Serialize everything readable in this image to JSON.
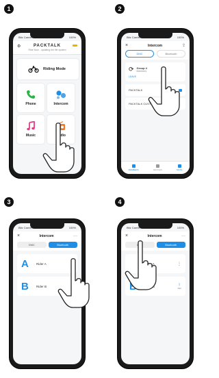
{
  "steps": [
    {
      "badge": "1"
    },
    {
      "badge": "2"
    },
    {
      "badge": "3"
    },
    {
      "badge": "4"
    }
  ],
  "status_bar": {
    "carrier": "Bitz Carrier",
    "time": "9:41 AM",
    "battery": "100%"
  },
  "screen1": {
    "brand": "PACKTALK",
    "tagline": "Ride Now - updating the file system",
    "riding_mode": "Riding Mode",
    "phone": "Phone",
    "intercom": "Intercom",
    "music": "Music",
    "radio": "Radio"
  },
  "screen2": {
    "title": "Intercom",
    "tab_dmc": "DMC",
    "tab_bluetooth": "Bluetooth",
    "group_name": "Group 4",
    "group_sub": "Members",
    "group_link": "LEAVE",
    "row1": "PACKTALK",
    "row2": "PACKTALK CUSTOM",
    "nav": [
      "MEMBERS",
      "DEVICES",
      "MUTE"
    ]
  },
  "screen3": {
    "title": "Intercom",
    "seg_dmc": "DMC",
    "seg_bluetooth": "Bluetooth",
    "rider_a_letter": "A",
    "rider_a": "Rider A",
    "rider_b_letter": "B",
    "rider_b": "Rider B"
  },
  "screen4": {
    "title": "Intercom",
    "seg_dmc": "DMC",
    "seg_bluetooth": "Bluetooth",
    "rider_a": "Rider A",
    "rider_b_letter": "B",
    "rider_b": "Rider B",
    "pair_label": "Pair"
  },
  "colors": {
    "accent": "#1f8ee6",
    "phone_body": "#1a1a1a",
    "screen_bg": "#f5f6f8"
  }
}
